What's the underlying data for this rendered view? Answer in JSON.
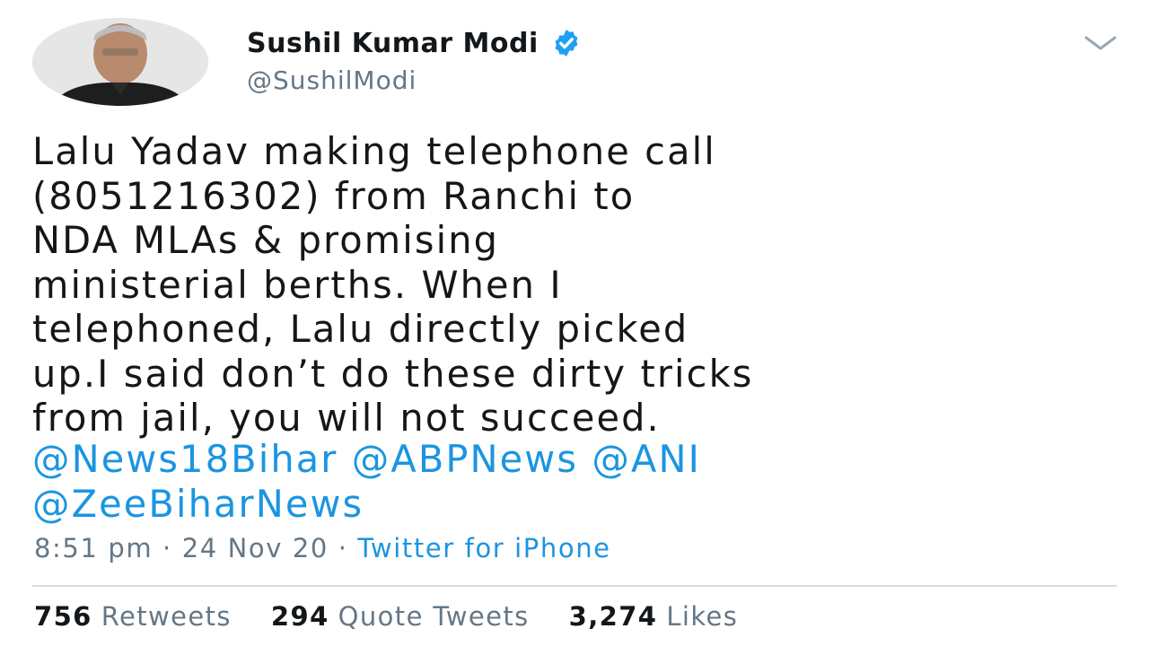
{
  "author": {
    "display_name": "Sushil Kumar Modi",
    "handle": "@SushilModi"
  },
  "tweet": {
    "text": "Lalu Yadav making telephone call\n(8051216302) from Ranchi to\nNDA MLAs & promising\nministerial berths. When I\ntelephoned, Lalu directly picked\nup.I said don’t do these dirty tricks\nfrom jail, you will not succeed.",
    "mentions": [
      "@News18Bihar",
      "@ABPNews",
      "@ANI",
      "@ZeeBiharNews"
    ],
    "time": "8:51 pm",
    "separator": "·",
    "date": "24 Nov 20",
    "source": "Twitter for iPhone"
  },
  "stats": {
    "retweets_count": "756",
    "retweets_label": "Retweets",
    "quotes_count": "294",
    "quotes_label": "Quote Tweets",
    "likes_count": "3,274",
    "likes_label": "Likes"
  },
  "icons": {
    "verified": "verified-badge-icon",
    "menu": "chevron-down-icon"
  },
  "colors": {
    "link": "#1b95e0",
    "secondary": "#657786",
    "verified": "#1da1f2"
  }
}
